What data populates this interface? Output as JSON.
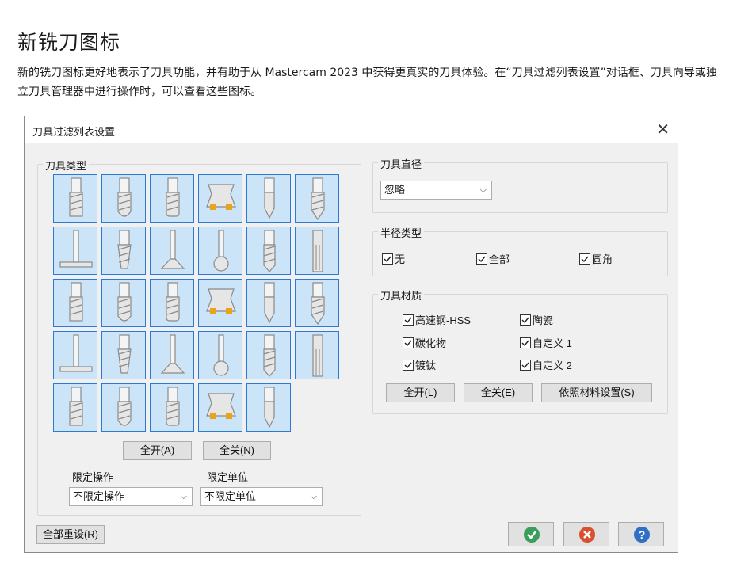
{
  "doc": {
    "title": "新铣刀图标",
    "description": "新的铣刀图标更好地表示了刀具功能，并有助于从 Mastercam 2023 中获得更真实的刀具体验。在“刀具过滤列表设置”对话框、刀具向导或独立刀具管理器中进行操作时，可以查看这些图标。"
  },
  "dialog": {
    "title": "刀具过滤列表设置",
    "close_icon": "close-icon",
    "tool_types": {
      "label": "刀具类型",
      "tools": [
        {
          "name": "flat-endmill",
          "icon": "flat-endmill-icon"
        },
        {
          "name": "ball-endmill",
          "icon": "ball-endmill-icon"
        },
        {
          "name": "bull-endmill",
          "icon": "bull-endmill-icon"
        },
        {
          "name": "face-mill",
          "icon": "face-mill-icon"
        },
        {
          "name": "center-drill",
          "icon": "center-drill-icon"
        },
        {
          "name": "spot-drill",
          "icon": "spot-drill-icon"
        },
        {
          "name": "slot-mill",
          "icon": "slot-mill-icon"
        },
        {
          "name": "taper-mill",
          "icon": "taper-mill-icon"
        },
        {
          "name": "dovetail-mill",
          "icon": "dovetail-mill-icon"
        },
        {
          "name": "lollipop-mill",
          "icon": "lollipop-mill-icon"
        },
        {
          "name": "drill",
          "icon": "drill-icon"
        },
        {
          "name": "reamer",
          "icon": "reamer-icon"
        },
        {
          "name": "boring-bar",
          "icon": "boring-bar-icon"
        },
        {
          "name": "right-hand-tap",
          "icon": "right-hand-tap-icon"
        },
        {
          "name": "left-hand-tap",
          "icon": "left-hand-tap-icon"
        },
        {
          "name": "chamfer-mill",
          "icon": "chamfer-mill-icon"
        },
        {
          "name": "step-drill",
          "icon": "step-drill-icon"
        },
        {
          "name": "thread-mill",
          "icon": "thread-mill-icon"
        },
        {
          "name": "countersink",
          "icon": "countersink-icon"
        },
        {
          "name": "form-tool",
          "icon": "form-tool-icon"
        },
        {
          "name": "engrave-tool",
          "icon": "engrave-tool-icon"
        },
        {
          "name": "taper-ball-mill",
          "icon": "taper-ball-mill-icon"
        },
        {
          "name": "barrel-mill",
          "icon": "barrel-mill-icon"
        },
        {
          "name": "single-thread-mill",
          "icon": "single-thread-mill-icon"
        },
        {
          "name": "taper-bull-mill",
          "icon": "taper-bull-mill-icon"
        },
        {
          "name": "oval-form-mill",
          "icon": "oval-form-mill-icon"
        },
        {
          "name": "lens-mill",
          "icon": "lens-mill-icon"
        },
        {
          "name": "circle-segment-mill",
          "icon": "circle-segment-mill-icon"
        },
        {
          "name": "indexable-insert-mill",
          "icon": "indexable-insert-mill-icon"
        }
      ],
      "select_all": "全开(A)",
      "select_none": "全关(N)",
      "op_limit_label": "限定操作",
      "op_limit_value": "不限定操作",
      "unit_limit_label": "限定单位",
      "unit_limit_value": "不限定单位"
    },
    "diameter": {
      "label": "刀具直径",
      "value": "忽略"
    },
    "radius_type": {
      "label": "半径类型",
      "options": [
        {
          "label": "无",
          "checked": true
        },
        {
          "label": "全部",
          "checked": true
        },
        {
          "label": "圆角",
          "checked": true
        }
      ]
    },
    "material": {
      "label": "刀具材质",
      "options": [
        {
          "label": "高速钢-HSS",
          "checked": true
        },
        {
          "label": "陶瓷",
          "checked": true
        },
        {
          "label": "碳化物",
          "checked": true
        },
        {
          "label": "自定义 1",
          "checked": true
        },
        {
          "label": "镀钛",
          "checked": true
        },
        {
          "label": "自定义 2",
          "checked": true
        }
      ],
      "select_all": "全开(L)",
      "select_none": "全关(E)",
      "by_material": "依照材料设置(S)"
    },
    "reset_all": "全部重设(R)",
    "ok_icon": "check-icon",
    "cancel_icon": "cancel-icon",
    "help_icon": "help-icon",
    "help_glyph": "?",
    "colors": {
      "ok": "#3a9d5a",
      "cancel": "#d9502e",
      "help": "#2f6fc4",
      "tile_bg": "#cce4f7",
      "tile_border": "#2d7ad6",
      "tool_grey": "#8a8a8a",
      "insert": "#e8a51c"
    }
  }
}
